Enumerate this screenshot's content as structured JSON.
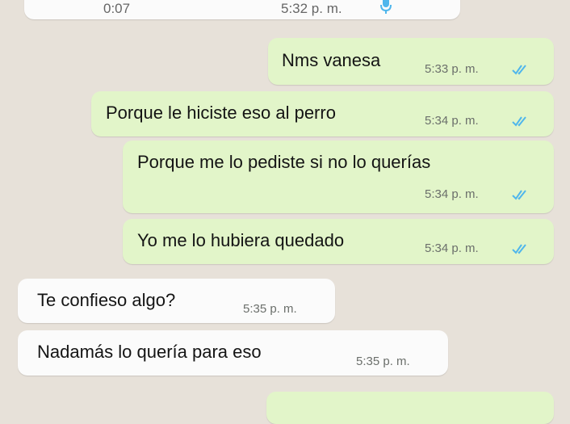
{
  "top_message": {
    "duration": "0:07",
    "time": "5:32 p. m."
  },
  "messages": [
    {
      "direction": "sent",
      "text": "Nms vanesa",
      "time": "5:33 p. m.",
      "status": "read"
    },
    {
      "direction": "sent",
      "text": "Porque le hiciste eso al perro",
      "time": "5:34 p. m.",
      "status": "read"
    },
    {
      "direction": "sent",
      "text": "Porque me lo pediste si no lo querías",
      "time": "5:34 p. m.",
      "status": "read"
    },
    {
      "direction": "sent",
      "text": "Yo me lo hubiera quedado",
      "time": "5:34 p. m.",
      "status": "read"
    },
    {
      "direction": "received",
      "text": "Te confieso algo?",
      "time": "5:35 p. m."
    },
    {
      "direction": "received",
      "text": "Nadamás lo quería para eso",
      "time": "5:35 p. m."
    }
  ],
  "colors": {
    "background": "#e7e1d9",
    "sent_bubble": "#e2f5c9",
    "received_bubble": "#fbfbfb",
    "read_ticks": "#4fb6ec",
    "mic_icon": "#4fb6ec"
  }
}
